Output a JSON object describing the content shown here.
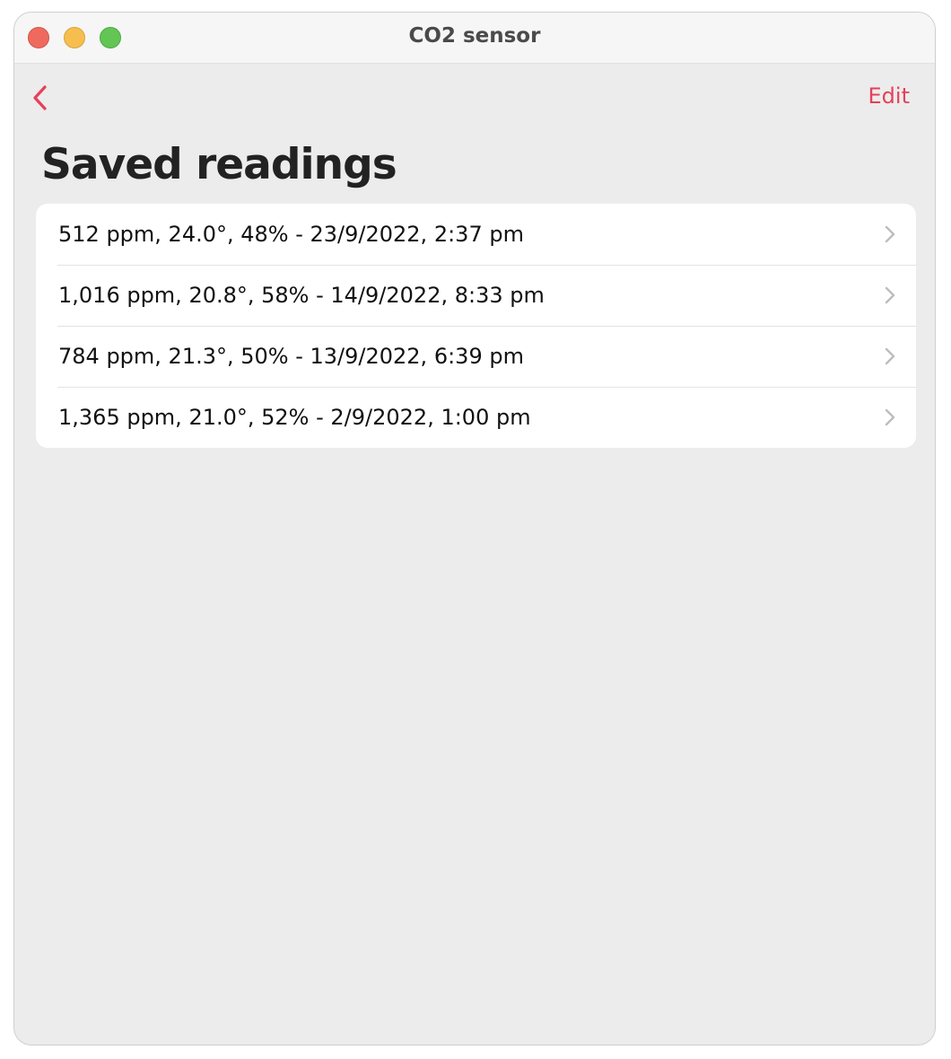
{
  "window": {
    "title": "CO2 sensor"
  },
  "navbar": {
    "back_icon": "chevron-left-icon",
    "edit_label": "Edit",
    "accent_color": "#e5405a"
  },
  "page": {
    "title": "Saved readings"
  },
  "readings": [
    {
      "label": "512 ppm, 24.0°, 48% - 23/9/2022, 2:37 pm"
    },
    {
      "label": "1,016 ppm, 20.8°, 58% - 14/9/2022, 8:33 pm"
    },
    {
      "label": "784 ppm, 21.3°, 50% - 13/9/2022, 6:39 pm"
    },
    {
      "label": "1,365 ppm, 21.0°, 52% - 2/9/2022, 1:00 pm"
    }
  ]
}
